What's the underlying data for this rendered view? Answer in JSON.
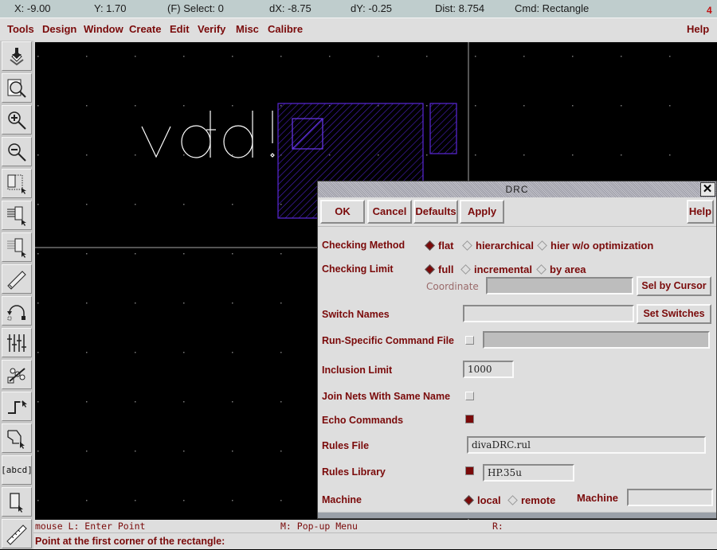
{
  "status": {
    "x": "X: -9.00",
    "y": "Y: 1.70",
    "select": "(F) Select: 0",
    "dx": "dX: -8.75",
    "dy": "dY: -0.25",
    "dist": "Dist: 8.754",
    "cmd": "Cmd: Rectangle",
    "window_number": "4"
  },
  "menu": {
    "items": [
      "Tools",
      "Design",
      "Window",
      "Create",
      "Edit",
      "Verify",
      "Misc",
      "Calibre"
    ],
    "help": "Help"
  },
  "toolbar": {
    "tools": [
      {
        "icon": "save-icon"
      },
      {
        "icon": "fit-view-icon"
      },
      {
        "icon": "zoom-in-icon"
      },
      {
        "icon": "zoom-out-icon"
      },
      {
        "icon": "stretch-icon"
      },
      {
        "icon": "copy-icon"
      },
      {
        "icon": "move-icon"
      },
      {
        "icon": "ruler-icon"
      },
      {
        "icon": "undo-icon"
      },
      {
        "icon": "property-icon"
      },
      {
        "icon": "instance-icon"
      },
      {
        "icon": "path-icon"
      },
      {
        "icon": "polygon-icon"
      },
      {
        "icon": "label-icon",
        "text": "[abcd]"
      },
      {
        "icon": "rectangle-icon"
      },
      {
        "icon": "ruler-icon"
      }
    ]
  },
  "canvas": {
    "label_text": "vdd!",
    "layer_color": "#5a28d8",
    "grid_dot_color": "#7a7a7a"
  },
  "dialog": {
    "title": "DRC",
    "buttons": {
      "ok": "OK",
      "cancel": "Cancel",
      "defaults": "Defaults",
      "apply": "Apply",
      "help": "Help"
    },
    "checking_method": {
      "label": "Checking Method",
      "options": [
        "flat",
        "hierarchical",
        "hier w/o optimization"
      ],
      "selected": "flat"
    },
    "checking_limit": {
      "label": "Checking Limit",
      "options": [
        "full",
        "incremental",
        "by area"
      ],
      "selected": "full"
    },
    "coordinate": {
      "label": "Coordinate",
      "value": "",
      "button": "Sel by Cursor"
    },
    "switch_names": {
      "label": "Switch Names",
      "value": "",
      "button": "Set Switches"
    },
    "run_specific": {
      "label": "Run-Specific Command File",
      "checked": false,
      "value": ""
    },
    "inclusion_limit": {
      "label": "Inclusion Limit",
      "value": "1000"
    },
    "join_nets": {
      "label": "Join Nets With Same Name",
      "checked": false
    },
    "echo_commands": {
      "label": "Echo Commands",
      "checked": true
    },
    "rules_file": {
      "label": "Rules File",
      "value": "divaDRC.rul"
    },
    "rules_library": {
      "label": "Rules Library",
      "checked": true,
      "value": "HP.35u"
    },
    "machine": {
      "label": "Machine",
      "options": [
        "local",
        "remote"
      ],
      "selected": "local",
      "machine_label": "Machine",
      "machine_value": ""
    }
  },
  "bottom": {
    "mouse_l": "mouse L: Enter Point",
    "mouse_m": "M: Pop-up Menu",
    "mouse_r": "R:",
    "prompt": "Point at the first corner of the rectangle:"
  }
}
